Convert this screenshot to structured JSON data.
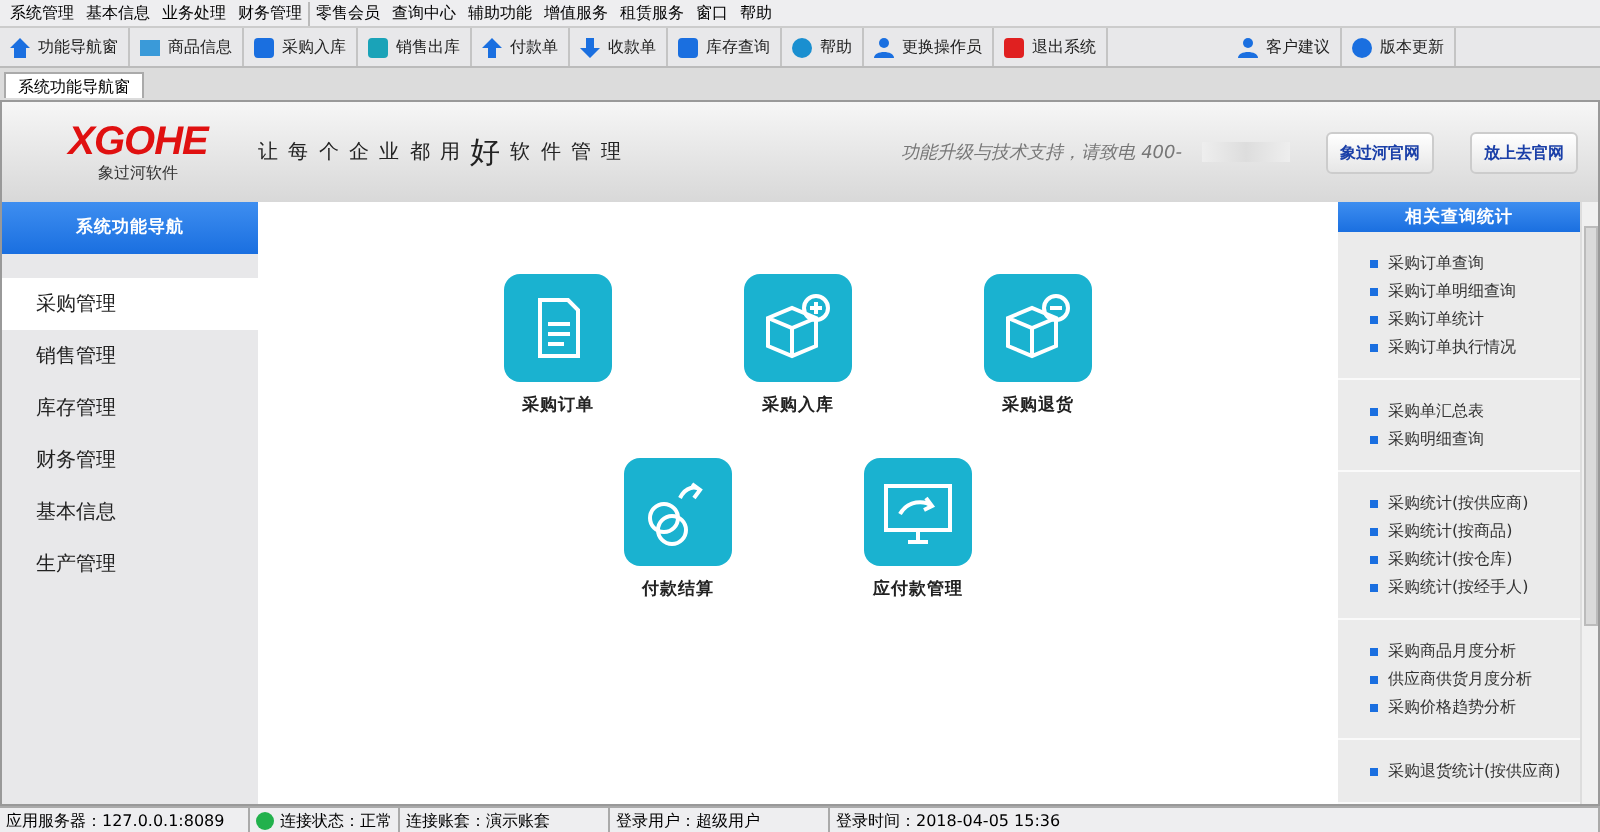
{
  "menu_bar": [
    [
      "系统管理",
      "基本信息",
      "业务处理",
      "财务管理"
    ],
    [
      "零售会员",
      "查询中心",
      "辅助功能",
      "增值服务",
      "租赁服务",
      "窗口",
      "帮助"
    ]
  ],
  "toolbar": [
    {
      "label": "功能导航窗",
      "kind": "home"
    },
    {
      "label": "商品信息",
      "kind": "card"
    },
    {
      "label": "采购入库",
      "kind": "in"
    },
    {
      "label": "销售出库",
      "kind": "out"
    },
    {
      "label": "付款单",
      "kind": "up"
    },
    {
      "label": "收款单",
      "kind": "down"
    },
    {
      "label": "库存查询",
      "kind": "search"
    },
    {
      "label": "帮助",
      "kind": "help"
    },
    {
      "label": "更换操作员",
      "kind": "user"
    },
    {
      "label": "退出系统",
      "kind": "exit"
    },
    {
      "label": "客户建议",
      "kind": "people"
    },
    {
      "label": "版本更新",
      "kind": "globe"
    }
  ],
  "tabs": [
    {
      "label": "系统功能导航窗",
      "selected": true
    }
  ],
  "header": {
    "logo": "XGOHE",
    "logo_sub": "象过河软件",
    "slogan_before": "让 每 个 企 业 都 用",
    "slogan_big": "好",
    "slogan_after": "软 件 管 理",
    "support": "功能升级与技术支持，请致电 400-",
    "links": [
      "象过河官网",
      "放上去官网"
    ]
  },
  "nav": {
    "title": "系统功能导航",
    "items": [
      {
        "label": "采购管理",
        "selected": true
      },
      {
        "label": "销售管理",
        "selected": false
      },
      {
        "label": "库存管理",
        "selected": false
      },
      {
        "label": "财务管理",
        "selected": false
      },
      {
        "label": "基本信息",
        "selected": false
      },
      {
        "label": "生产管理",
        "selected": false
      }
    ]
  },
  "functions": [
    {
      "label": "采购订单",
      "kind": "doc"
    },
    {
      "label": "采购入库",
      "kind": "box-plus"
    },
    {
      "label": "采购退货",
      "kind": "box-minus"
    },
    {
      "label": "付款结算",
      "kind": "coins"
    },
    {
      "label": "应付款管理",
      "kind": "monitor"
    }
  ],
  "related": {
    "title": "相关查询统计",
    "groups": [
      [
        "采购订单查询",
        "采购订单明细查询",
        "采购订单统计",
        "采购订单执行情况"
      ],
      [
        "采购单汇总表",
        "采购明细查询"
      ],
      [
        "采购统计(按供应商)",
        "采购统计(按商品)",
        "采购统计(按仓库)",
        "采购统计(按经手人)"
      ],
      [
        "采购商品月度分析",
        "供应商供货月度分析",
        "采购价格趋势分析"
      ],
      [
        "采购退货统计(按供应商)"
      ]
    ]
  },
  "status_bar": [
    {
      "label": "应用服务器：127.0.0.1:8089",
      "kind": "text"
    },
    {
      "label": "连接状态：正常",
      "kind": "status",
      "color": "#22b14c"
    },
    {
      "label": "连接账套：演示账套",
      "kind": "text"
    },
    {
      "label": "登录用户：超级用户",
      "kind": "text"
    },
    {
      "label": "登录时间：2018-04-05 15:36",
      "kind": "text"
    }
  ]
}
